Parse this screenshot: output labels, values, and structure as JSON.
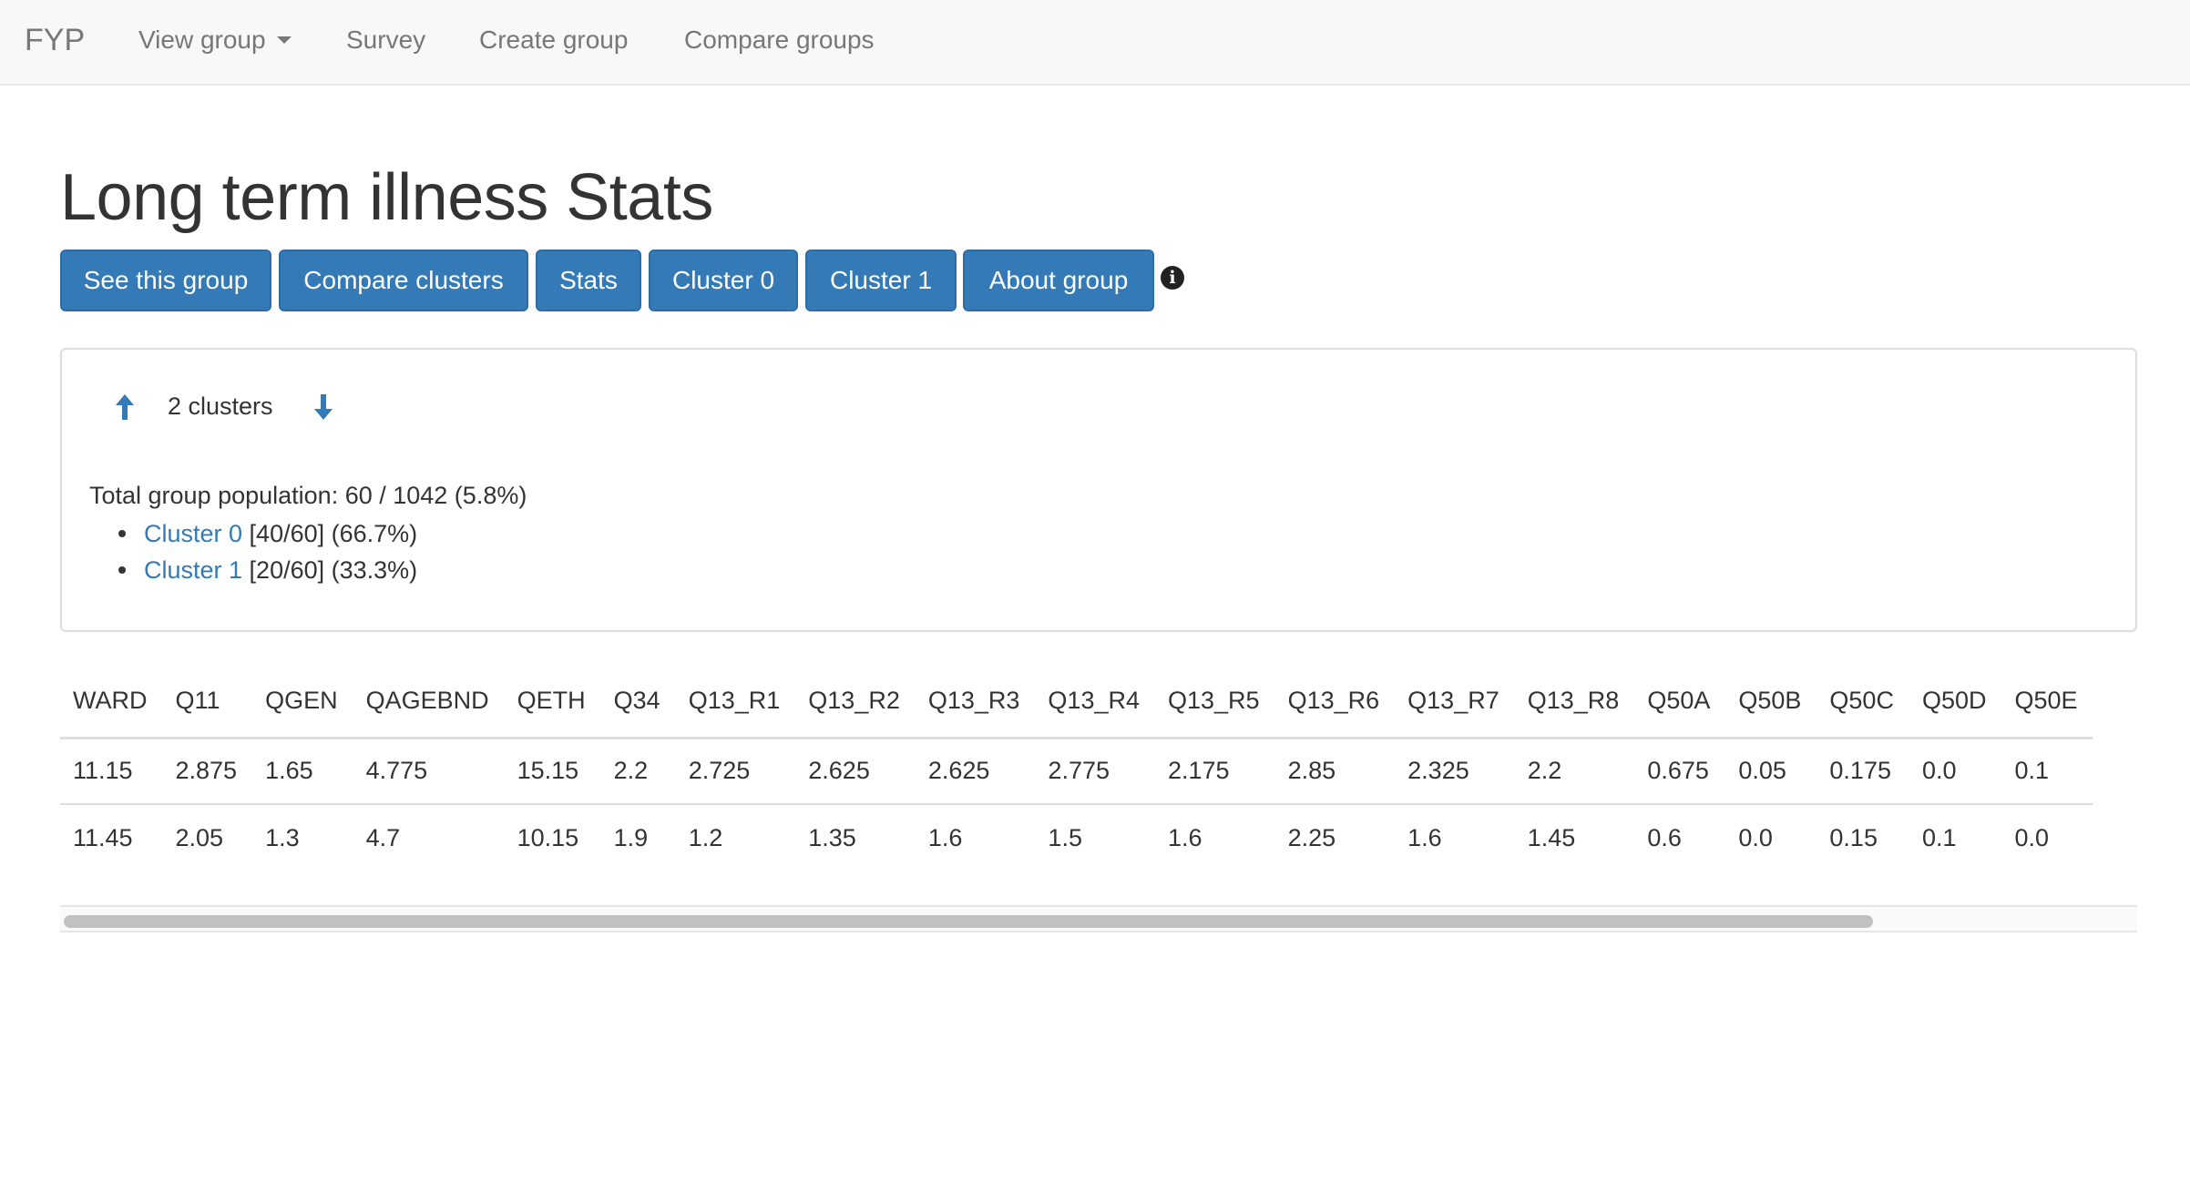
{
  "navbar": {
    "brand": "FYP",
    "items": [
      {
        "label": "View group"
      },
      {
        "label": "Survey"
      },
      {
        "label": "Create group"
      },
      {
        "label": "Compare groups"
      }
    ]
  },
  "page": {
    "title": "Long term illness Stats"
  },
  "buttons": [
    {
      "label": "See this group"
    },
    {
      "label": "Compare clusters"
    },
    {
      "label": "Stats"
    },
    {
      "label": "Cluster 0"
    },
    {
      "label": "Cluster 1"
    },
    {
      "label": "About group"
    }
  ],
  "info_icon": "info-circle-icon",
  "panel": {
    "cluster_count": "2 clusters",
    "total_population": "Total group population: 60 / 1042 (5.8%)",
    "clusters": [
      {
        "link": "Cluster 0",
        "detail": " [40/60] (66.7%)"
      },
      {
        "link": "Cluster 1",
        "detail": " [20/60] (33.3%)"
      }
    ]
  },
  "table": {
    "columns": [
      "WARD",
      "Q11",
      "QGEN",
      "QAGEBND",
      "QETH",
      "Q34",
      "Q13_R1",
      "Q13_R2",
      "Q13_R3",
      "Q13_R4",
      "Q13_R5",
      "Q13_R6",
      "Q13_R7",
      "Q13_R8",
      "Q50A",
      "Q50B",
      "Q50C",
      "Q50D",
      "Q50E"
    ],
    "rows": [
      [
        "11.15",
        "2.875",
        "1.65",
        "4.775",
        "15.15",
        "2.2",
        "2.725",
        "2.625",
        "2.625",
        "2.775",
        "2.175",
        "2.85",
        "2.325",
        "2.2",
        "0.675",
        "0.05",
        "0.175",
        "0.0",
        "0.1"
      ],
      [
        "11.45",
        "2.05",
        "1.3",
        "4.7",
        "10.15",
        "1.9",
        "1.2",
        "1.35",
        "1.6",
        "1.5",
        "1.6",
        "2.25",
        "1.6",
        "1.45",
        "0.6",
        "0.0",
        "0.15",
        "0.1",
        "0.0"
      ]
    ],
    "scroll_position": 0.0
  },
  "colors": {
    "primary": "#337ab7",
    "navbar_bg": "#f8f8f8",
    "nav_text": "#777777",
    "text": "#333333"
  }
}
